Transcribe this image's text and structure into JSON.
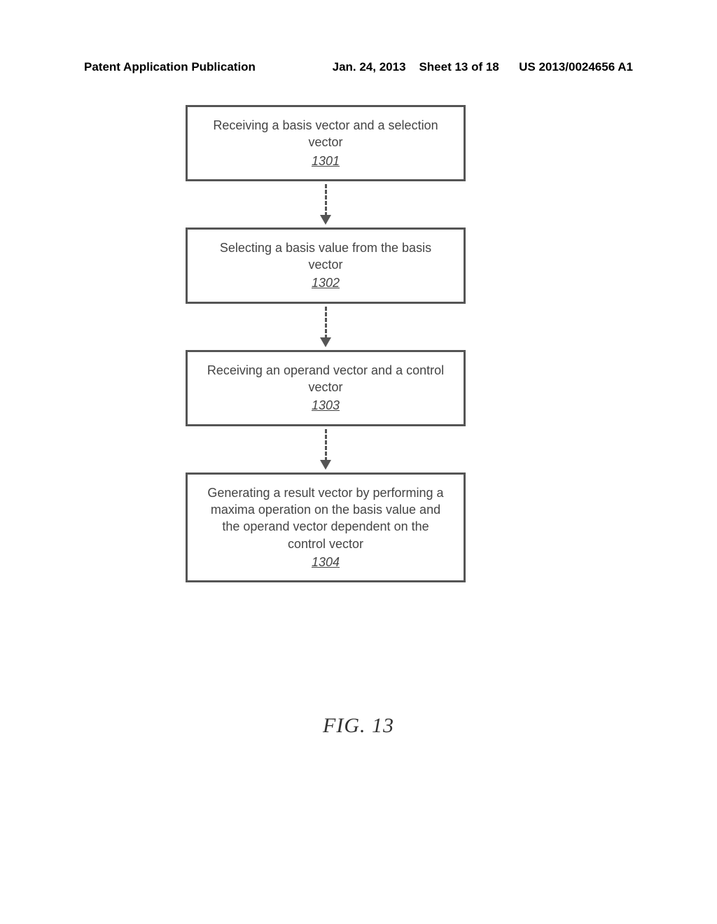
{
  "header": {
    "left": "Patent Application Publication",
    "date": "Jan. 24, 2013",
    "sheet": "Sheet 13 of 18",
    "pubno": "US 2013/0024656 A1"
  },
  "flow": {
    "steps": [
      {
        "text": "Receiving a basis vector and a selection vector",
        "ref": "1301"
      },
      {
        "text": "Selecting a basis value from the basis vector",
        "ref": "1302"
      },
      {
        "text": "Receiving an operand vector and a control vector",
        "ref": "1303"
      },
      {
        "text": "Generating a result vector by performing a maxima operation on the basis value and the operand vector dependent on the control vector",
        "ref": "1304"
      }
    ]
  },
  "figure_label": "FIG. 13"
}
